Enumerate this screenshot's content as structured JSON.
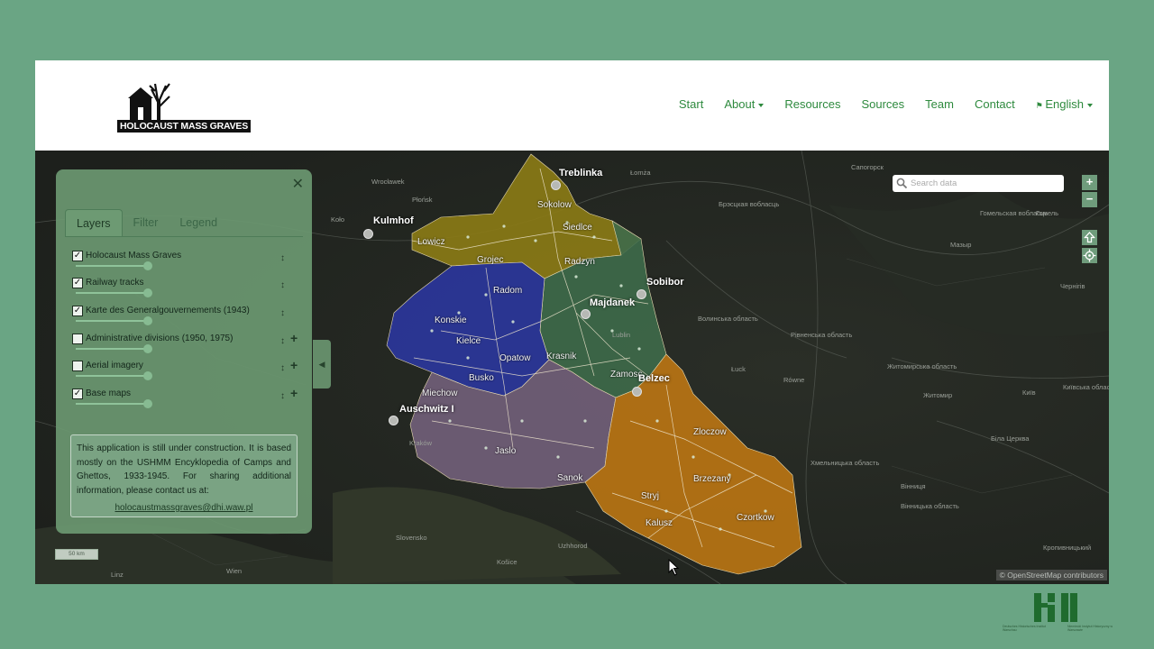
{
  "header": {
    "logo_text": "HOLOCAUST MASS GRAVES",
    "nav": [
      {
        "label": "Start",
        "dropdown": false
      },
      {
        "label": "About",
        "dropdown": true
      },
      {
        "label": "Resources",
        "dropdown": false
      },
      {
        "label": "Sources",
        "dropdown": false
      },
      {
        "label": "Team",
        "dropdown": false
      },
      {
        "label": "Contact",
        "dropdown": false
      },
      {
        "label": "English",
        "dropdown": true,
        "icon": "flag-icon"
      }
    ],
    "accent_color": "#2e8a3e"
  },
  "panel": {
    "tabs": [
      "Layers",
      "Filter",
      "Legend"
    ],
    "active_tab": "Layers",
    "layers": [
      {
        "name": "Holocaust Mass Graves",
        "checked": true,
        "opacity": 1.0,
        "addable": false
      },
      {
        "name": "Railway tracks",
        "checked": true,
        "opacity": 1.0,
        "addable": false
      },
      {
        "name": "Karte des Generalgouvernements (1943)",
        "checked": true,
        "opacity": 1.0,
        "addable": false
      },
      {
        "name": "Administrative divisions (1950, 1975)",
        "checked": false,
        "opacity": 1.0,
        "addable": true
      },
      {
        "name": "Aerial imagery",
        "checked": false,
        "opacity": 1.0,
        "addable": true
      },
      {
        "name": "Base maps",
        "checked": true,
        "opacity": 1.0,
        "addable": true
      }
    ],
    "info_text": "This application is still under construction. It is based mostly on the USHMM Encyklopedia of Camps and Ghettos, 1933-1945. For sharing additional information, please contact us at:",
    "contact_email": "holocaustmassgraves@dhi.waw.pl"
  },
  "map": {
    "search_placeholder": "Search data",
    "zoom_in": "+",
    "zoom_out": "−",
    "scale_label": "50 km",
    "attribution": "© OpenStreetMap contributors",
    "camps": [
      "Treblinka",
      "Kulmhof",
      "Sobibor",
      "Majdanek",
      "Belzec",
      "Auschwitz I"
    ],
    "region_labels": [
      "Sokolow",
      "Siedlce",
      "Lowicz",
      "Grojec",
      "Radzyn",
      "Radom",
      "Konskie",
      "Kielce",
      "Opatow",
      "Krasnik",
      "Busko",
      "Zamosc",
      "Miechow",
      "Zloczow",
      "Jaslo",
      "Sanok",
      "Brzezany",
      "Stryj",
      "Czortkow",
      "Kalusz"
    ],
    "basemap_labels": [
      "Wrocławek",
      "Płońsk",
      "Koło",
      "Łomża",
      "Сапогорск",
      "Брэсцкая вобласць",
      "Гомельская вобласць",
      "Гомель",
      "Мазыр",
      "Slovensko",
      "Чернігів",
      "Волинська область",
      "Рівненська область",
      "Житомирська область",
      "Житомир",
      "Київ",
      "Київська область",
      "Біла Церква",
      "Вінниця",
      "Вінницька область",
      "Хмельницька область",
      "Кропивницький",
      "Linz",
      "Wien",
      "Kraków",
      "Košice",
      "Uzhhorod",
      "Lublin",
      "Łuck",
      "Równe"
    ]
  },
  "footer_logo": {
    "left_text": "Deutsches Historisches Institut Warschau",
    "right_text": "Niemiecki Instytut Historyczny w Warszawie"
  }
}
